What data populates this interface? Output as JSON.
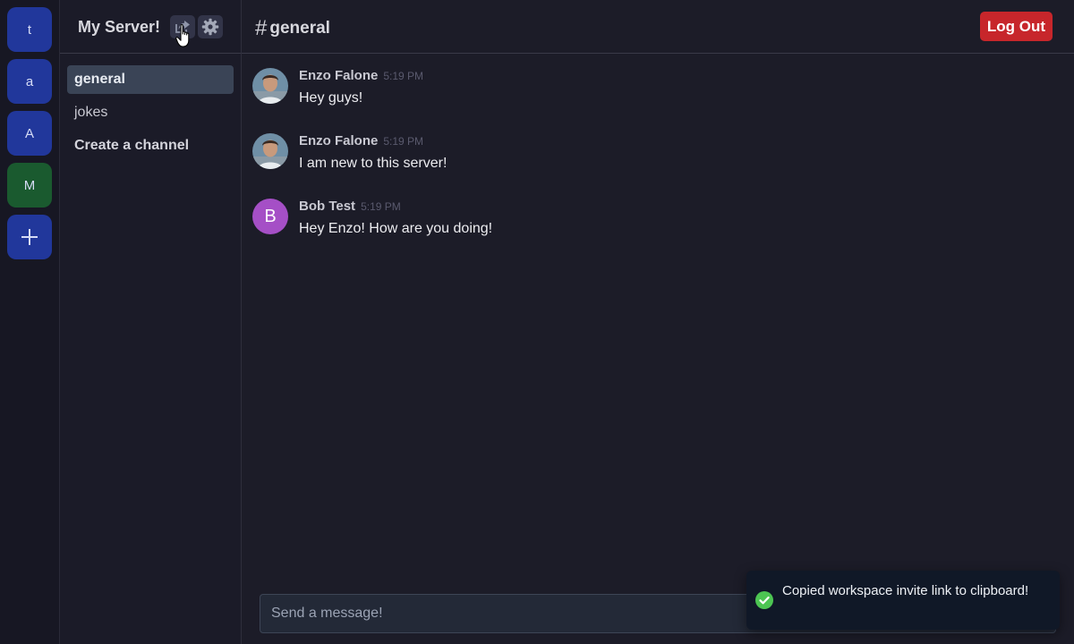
{
  "servers": [
    {
      "label": "t",
      "color": "#21379b"
    },
    {
      "label": "a",
      "color": "#21379b"
    },
    {
      "label": "A",
      "color": "#21379b"
    },
    {
      "label": "M",
      "color": "#1a5a2f"
    }
  ],
  "add_server": {
    "icon": "plus-icon"
  },
  "server_header": {
    "name": "My Server!",
    "share_icon": "share-icon",
    "settings_icon": "gear-icon"
  },
  "channels": [
    {
      "label": "general",
      "active": true
    },
    {
      "label": "jokes",
      "active": false
    }
  ],
  "create_channel_label": "Create a channel",
  "main_header": {
    "hash": "#",
    "channel": "general",
    "logout_label": "Log Out",
    "logout_color": "#c7262b"
  },
  "messages": [
    {
      "author": "Enzo Falone",
      "time": "5:19 PM",
      "text": "Hey guys!",
      "avatar": "photo"
    },
    {
      "author": "Enzo Falone",
      "time": "5:19 PM",
      "text": "I am new to this server!",
      "avatar": "photo"
    },
    {
      "author": "Bob Test",
      "time": "5:19 PM",
      "text": "Hey Enzo! How are you doing!",
      "avatar": "B"
    }
  ],
  "composer": {
    "placeholder": "Send a message!"
  },
  "toast": {
    "text": "Copied workspace invite link to clipboard!",
    "icon": "check-circle-icon",
    "icon_color": "#4cc552"
  }
}
